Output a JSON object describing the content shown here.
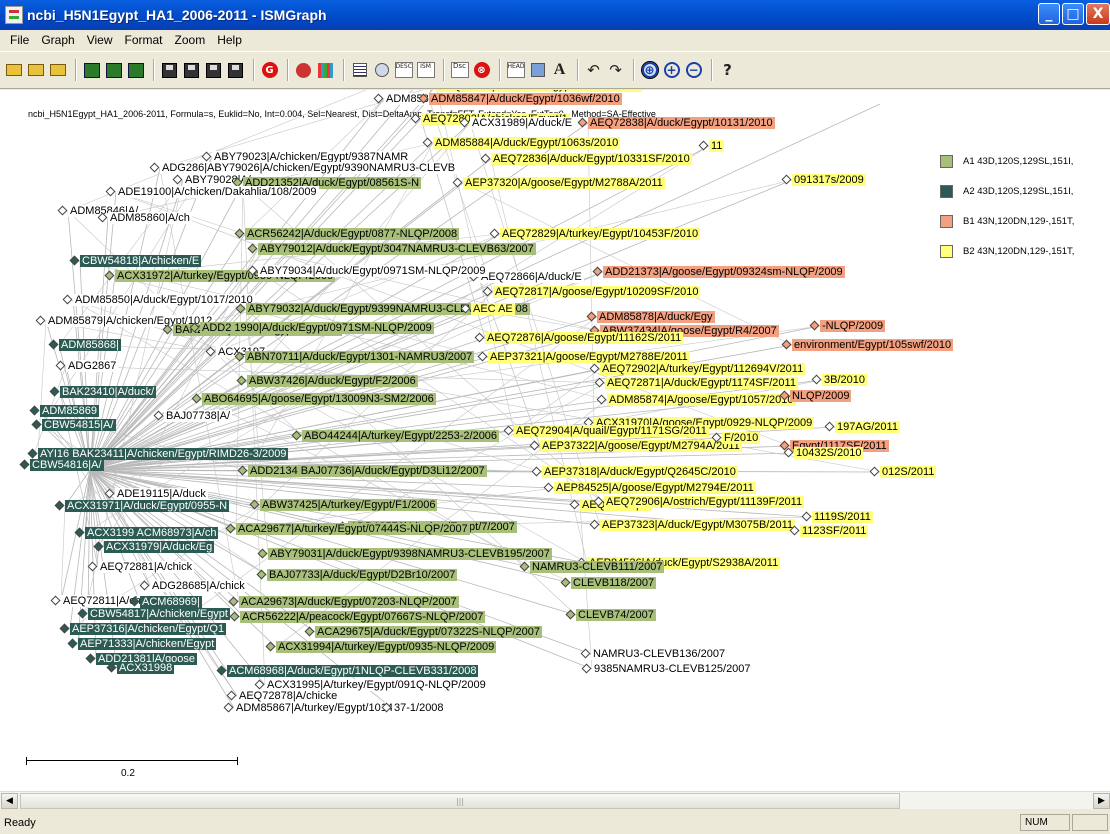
{
  "window": {
    "title": "ncbi_H5N1Egypt_HA1_2006-2011 - ISMGraph",
    "minimize": "_",
    "maximize": "□",
    "close": "X"
  },
  "menu": [
    "File",
    "Graph",
    "View",
    "Format",
    "Zoom",
    "Help"
  ],
  "toolbar": {
    "icons": [
      "open-icon",
      "open-icon",
      "open-icon",
      "emf-icon",
      "wmf-icon",
      "emf-icon",
      "save-icon",
      "save-icon",
      "save-icon",
      "red-g-icon",
      "tree-icon",
      "grid-icon",
      "list-icon",
      "globe-icon",
      "desc-icon",
      "ism-icon",
      "dsc-icon",
      "cancel-icon",
      "head-icon",
      "table-icon",
      "font-icon",
      "rotate-left-icon",
      "rotate-right-icon",
      "zoom-fit-icon",
      "zoom-in-icon",
      "zoom-out-icon",
      "help-icon"
    ],
    "desc": "DESC",
    "ism": "ISM",
    "head": "HEAD",
    "font": "A"
  },
  "canvas": {
    "info": "ncbi_H5N1Egypt_HA1_2006-2011, Formula=s, Euklid=No, Int=0.004, Sel=Nearest, Dist=DeltaAmp, Transf=FFT, Extend=Yes, ExtTo=0 , Method=SA-Effective",
    "scale": "0.2"
  },
  "legend": [
    {
      "color": "#a8bf7a",
      "label": "A1 43D,120S,129SL,151I,"
    },
    {
      "color": "#2c5b54",
      "label": "A2 43D,120S,129SL,151I,"
    },
    {
      "color": "#f2a07f",
      "label": "B1 43N,120DN,129-,151T,"
    },
    {
      "color": "#ffff7a",
      "label": "B2 43N,120DN,129-,151T,"
    }
  ],
  "labels": [
    {
      "t": "ABW37436|A/chicken/Egypt/R6/2007",
      "c": "B1"
    },
    {
      "t": "AEQ72905|A/chicken/Egypt/11529S/2011",
      "c": "B2"
    },
    {
      "t": "ADM85857|A/",
      "c": "none"
    },
    {
      "t": "ADM85847|A/duck/Egypt/1036wf/2010",
      "c": "B1"
    },
    {
      "t": "AEQ72803|A/chicken/Egypt/1",
      "c": "B2"
    },
    {
      "t": "ACX31989|A/duck/E",
      "c": "none"
    },
    {
      "t": "AEQ72838|A/duck/Egypt/10131/2010",
      "c": "B1"
    },
    {
      "t": "ADM85884|A/duck/Egypt/1063s/2010",
      "c": "B2"
    },
    {
      "t": "ABY79023|A/chicken/Egypt/9387NAMR",
      "c": "none"
    },
    {
      "t": "AEQ72836|A/duck/Egypt/10331SF/2010",
      "c": "B2"
    },
    {
      "t": "ADG286|ABY79026|A/chicken/Egypt/9390NAMRU3-CLEVB",
      "c": "none"
    },
    {
      "t": "ABY79028|A/",
      "c": "none"
    },
    {
      "t": "ADD21352|A/duck/Egypt/08561S-N",
      "c": "A1"
    },
    {
      "t": "AEP37320|A/goose/Egypt/M2788A/2011",
      "c": "B2"
    },
    {
      "t": "ADE19100|A/chicken/Dakahlia/108/2009",
      "c": "none"
    },
    {
      "t": "ADM85846|A/",
      "c": "none"
    },
    {
      "t": "ADM85860|A/ch",
      "c": "none"
    },
    {
      "t": "ACR56242|A/duck/Egypt/0877-NLQP/2008",
      "c": "A1"
    },
    {
      "t": "AEQ72829|A/turkey/Egypt/10453F/2010",
      "c": "B2"
    },
    {
      "t": "ABY79012|A/duck/Egypt/3047NAMRU3-CLEVB63/2007",
      "c": "A1"
    },
    {
      "t": "CBW54818|A/chicken/E",
      "c": "A2"
    },
    {
      "t": "ACX31972|A/turkey/Egypt/0959-NLQP/2009",
      "c": "A1"
    },
    {
      "t": "AEQ72866|A/duck/E",
      "c": "none"
    },
    {
      "t": "ADD21373|A/goose/Egypt/09324sm-NLQP/2009",
      "c": "B1"
    },
    {
      "t": "AEQ72817|A/goose/Egypt/10209SF/2010",
      "c": "B2"
    },
    {
      "t": "ADM85850|A/duck/Egypt/1017/2010",
      "c": "none"
    },
    {
      "t": "ABY79032|A/duck/Egypt/9399NAMRU3-CLEVB202/2008",
      "c": "A1"
    },
    {
      "t": "ADM85878|A/duck/Egy",
      "c": "B1"
    },
    {
      "t": "ABW37434|A/goose/Egypt/R4/2007",
      "c": "B1"
    },
    {
      "t": "ADM85879|A/chicken/Egypt/1012",
      "c": "none"
    },
    {
      "t": "BAK23402|A/duck/Egypt/D2/2007",
      "c": "A1"
    },
    {
      "t": "AEQ72876|A/goose/Egypt/11162S/2011",
      "c": "B2"
    },
    {
      "t": "ADM85868|",
      "c": "A2"
    },
    {
      "t": "ACX3197",
      "c": "none"
    },
    {
      "t": "ABN70711|A/duck/Egypt/1301-NAMRU3/2007",
      "c": "A1"
    },
    {
      "t": "AEP37321|A/goose/Egypt/M2788E/2011",
      "c": "B2"
    },
    {
      "t": "ADG2867",
      "c": "none"
    },
    {
      "t": "AEQ72902|A/turkey/Egypt/112694V/2011",
      "c": "B2"
    },
    {
      "t": "ABW37426|A/duck/Egypt/F2/2006",
      "c": "A1"
    },
    {
      "t": "AEQ72871|A/duck/Egypt/1174SF/2011",
      "c": "B2"
    },
    {
      "t": "BAK23410|A/duck/",
      "c": "A2"
    },
    {
      "t": "ABO64695|A/goose/Egypt/13009N3-SM2/2006",
      "c": "A1"
    },
    {
      "t": "ADM85874|A/goose/Egypt/1057/2010",
      "c": "B2"
    },
    {
      "t": "ADM85869",
      "c": "A2"
    },
    {
      "t": "BAJ07738|A/",
      "c": "none"
    },
    {
      "t": "ACX31970|A/goose/Egypt/0929-NLQP/2009",
      "c": "B2"
    },
    {
      "t": "AEQ72904|A/quail/Egypt/1171SG/2011",
      "c": "B2"
    },
    {
      "t": "CBW54815|A/",
      "c": "A2"
    },
    {
      "t": "ABO44244|A/turkey/Egypt/2253-2/2006",
      "c": "A1"
    },
    {
      "t": "AEP37322|A/goose/Egypt/M2794A/2011",
      "c": "B2"
    },
    {
      "t": "AYI16 BAK23411|A/chicken/Egypt/RIMD26-3/2009",
      "c": "A2"
    },
    {
      "t": "CBW54816|A/",
      "c": "A2"
    },
    {
      "t": "ADD2134 BAJ07736|A/duck/Egypt/D3Li12/2007",
      "c": "A1"
    },
    {
      "t": "AEP37318|A/duck/Egypt/Q2645C/2010",
      "c": "B2"
    },
    {
      "t": "ADE19115|A/duck",
      "c": "none"
    },
    {
      "t": "AEP84525|A/goose/Egypt/M2794E/2011",
      "c": "B2"
    },
    {
      "t": "ACX31971|A/duck/Egypt/0955-N",
      "c": "A2"
    },
    {
      "t": "ABW37425|A/turkey/Egypt/F1/2006",
      "c": "A1"
    },
    {
      "t": "AEQ72887|A/",
      "c": "B2"
    },
    {
      "t": "AEQ72906|A/ostrich/Egypt/11139F/2011",
      "c": "B2"
    },
    {
      "t": "ADD13576|A/turkey/Egypt/7/2007",
      "c": "A1"
    },
    {
      "t": "ACX3199 ACM68973|A/ch",
      "c": "A2"
    },
    {
      "t": "AEP37323|A/duck/Egypt/M3075B/2011",
      "c": "B2"
    },
    {
      "t": "ACA29677|A/turkey/Egypt/07444S-NLQP/2007",
      "c": "A1"
    },
    {
      "t": "ACX31979|A/duck/Eg",
      "c": "A2"
    },
    {
      "t": "ABY79031|A/duck/Egypt/9398NAMRU3-CLEVB195/2007",
      "c": "A1"
    },
    {
      "t": "AEP84526|A/duck/Egypt/S2938A/2011",
      "c": "B2"
    },
    {
      "t": "AEQ72881|A/chick",
      "c": "none"
    },
    {
      "t": "BAJ07733|A/duck/Egypt/D2Br10/2007",
      "c": "A1"
    },
    {
      "t": "ADG28685|A/chick",
      "c": "none"
    },
    {
      "t": "NAMRU3-CLEVB111/2007",
      "c": "A1"
    },
    {
      "t": "AEQ72811|A/chicken",
      "c": "none"
    },
    {
      "t": "ACM68969|",
      "c": "A2"
    },
    {
      "t": "ACA29673|A/duck/Egypt/07203-NLQP/2007",
      "c": "A1"
    },
    {
      "t": "CLEVB118/2007",
      "c": "A1"
    },
    {
      "t": "CBW54817|A/chicken/Egypt",
      "c": "A2"
    },
    {
      "t": "ACR56222|A/peacock/Egypt/07667S-NLQP/2007",
      "c": "A1"
    },
    {
      "t": "CLEVB74/2007",
      "c": "A1"
    },
    {
      "t": "AEP37316|A/chicken/Egypt/Q1",
      "c": "A2"
    },
    {
      "t": "ACA29675|A/duck/Egypt/07322S-NLQP/2007",
      "c": "A1"
    },
    {
      "t": "AEP71333|A/chicken/Egypt",
      "c": "A2"
    },
    {
      "t": "ACX31994|A/turkey/Egypt/0935-NLQP/2009",
      "c": "A1"
    },
    {
      "t": "ADD21381|A/goose",
      "c": "A2"
    },
    {
      "t": "NAMRU3-CLEVB136/2007",
      "c": "none"
    },
    {
      "t": "ACX31998",
      "c": "A2"
    },
    {
      "t": "9385NAMRU3-CLEVB125/2007",
      "c": "none"
    },
    {
      "t": "ACM68968|A/duck/Egypt/1NLQP-CLEVB331/2008",
      "c": "A2"
    },
    {
      "t": "ACX31995|A/turkey/Egypt/091Q-NLQP/2009",
      "c": "none"
    },
    {
      "t": "AEQ72878|A/chicke",
      "c": "none"
    },
    {
      "t": "ADM85867|A/turkey/Egypt/101474w/2010",
      "c": "none"
    },
    {
      "t": "37-1/2008",
      "c": "none"
    },
    {
      "t": "AEC AE",
      "c": "B2"
    },
    {
      "t": "ABY79034|A/duck/Egypt/0971SM-NLQP/2009",
      "c": "none"
    },
    {
      "t": "ADD2 1990|A/duck/Egypt/0971SM-NLQP/2009",
      "c": "A1"
    },
    {
      "t": "environment/Egypt/105swf/2010",
      "c": "B1"
    },
    {
      "t": "-NLQP/2009",
      "c": "B1"
    },
    {
      "t": "NLQP/2009",
      "c": "B1"
    },
    {
      "t": "197AG/2011",
      "c": "B2"
    },
    {
      "t": "012S/2011",
      "c": "B2"
    },
    {
      "t": "1119S/2011",
      "c": "B2"
    },
    {
      "t": "1123SF/2011",
      "c": "B2"
    },
    {
      "t": "Egypt/1117SF/2011",
      "c": "B1"
    },
    {
      "t": "3B/2010",
      "c": "B2"
    },
    {
      "t": "F/2010",
      "c": "B2"
    },
    {
      "t": "10432S/2010",
      "c": "B2"
    },
    {
      "t": "091317s/2009",
      "c": "B2"
    },
    {
      "t": "11",
      "c": "B2"
    }
  ]
}
